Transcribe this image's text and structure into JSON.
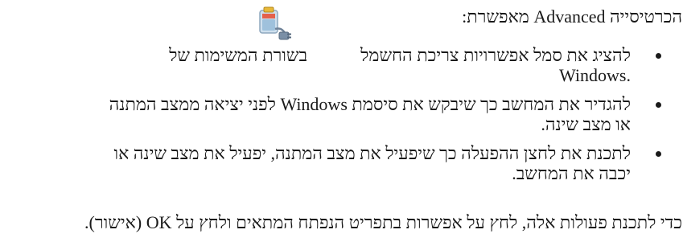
{
  "intro": "הכרטיסייה Advanced מאפשרת:",
  "icon": {
    "name": "power-options-icon",
    "colors": {
      "battery_body": "#cfe0ee",
      "battery_cap": "#e8b838",
      "plug": "#7a8fa6",
      "accent": "#e84a2e"
    }
  },
  "bullets": [
    {
      "line1_before": "להציג את סמל אפשרויות צריכת החשמל",
      "line1_after": "בשורת המשימות של",
      "line2": ".Windows"
    },
    {
      "line1": "להגדיר את המחשב כך שיבקש את סיסמת Windows לפני יציאה ממצב המתנה",
      "line2": "או מצב שינה."
    },
    {
      "line1": "לתכנת את לחצן ההפעלה כך שיפעיל את מצב המתנה, יפעיל את מצב שינה או",
      "line2": "יכבה את המחשב."
    }
  ],
  "outro": "כדי לתכנת פעולות אלה, לחץ על אפשרות בתפריט הנפתח המתאים ולחץ על OK (אישור)."
}
